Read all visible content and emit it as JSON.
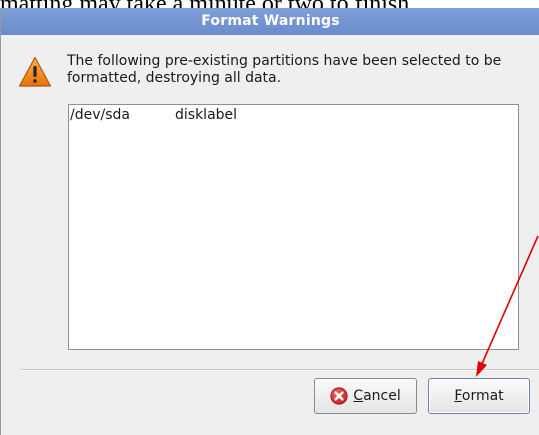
{
  "background": {
    "text": "matting may take a minute or two to finish."
  },
  "dialog": {
    "title": "Format Warnings",
    "icon": "warning-icon",
    "message": "The following pre-existing partitions have been selected to be formatted, destroying all data.",
    "partitions": [
      {
        "device": "/dev/sda",
        "type": "disklabel"
      }
    ],
    "buttons": {
      "cancel": {
        "mnemonic": "C",
        "rest": "ancel",
        "icon": "cancel-icon"
      },
      "format": {
        "mnemonic": "F",
        "rest": "ormat"
      }
    }
  },
  "colors": {
    "titlebar": "#7496d1",
    "annotation_arrow": "#e00000",
    "warning_icon": "#f08a1c",
    "cancel_icon": "#d92b2b"
  }
}
